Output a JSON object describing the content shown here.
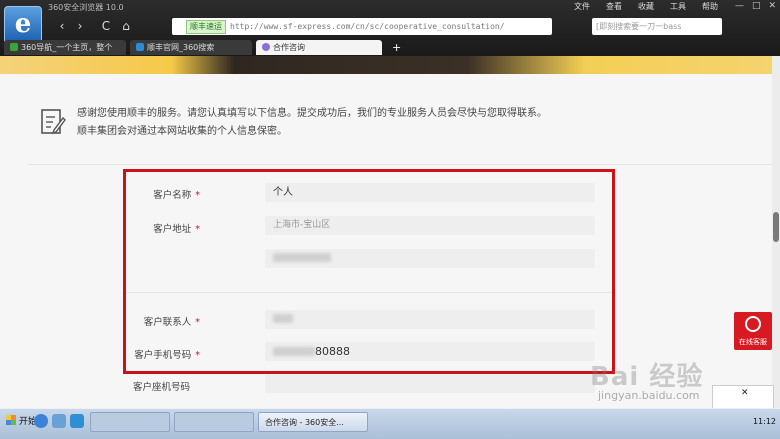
{
  "browser": {
    "app_title": "360安全浏览器 10.0",
    "menu": [
      "文件",
      "查看",
      "收藏",
      "工具",
      "帮助"
    ],
    "nav": {
      "back": "‹",
      "forward": "›",
      "reload": "C",
      "home": "⌂"
    },
    "address": {
      "badge": "顺丰速运",
      "url": "http://www.sf-express.com/cn/sc/cooperative_consultation/"
    },
    "search_placeholder": "[即刻搜索要一刀一bass",
    "tabs": [
      {
        "label": "360导航_一个主页，整个世界",
        "icon_color": "#3aa43a"
      },
      {
        "label": "顺丰官网_360搜索",
        "icon_color": "#2b8bd6"
      },
      {
        "label": "合作咨询",
        "icon_color": "#8a6fd8"
      }
    ],
    "new_tab": "+"
  },
  "page": {
    "notice": [
      "感谢您使用顺丰的服务。请您认真填写以下信息。提交成功后，我们的专业服务人员会尽快与您取得联系。",
      "顺丰集团会对通过本网站收集的个人信息保密。"
    ],
    "form": {
      "customer_name": {
        "label": "客户名称",
        "required": "*",
        "value": "个人"
      },
      "customer_address": {
        "label": "客户地址",
        "required": "*",
        "value": "上海市-宝山区"
      },
      "contact": {
        "label": "客户联系人",
        "required": "*"
      },
      "mobile": {
        "label": "客户手机号码",
        "required": "*",
        "value_suffix": "80888"
      },
      "landline": {
        "label": "客户座机号码"
      }
    },
    "customer_service": "在线客服"
  },
  "watermark": {
    "brand": "Bai 经验",
    "site": "jingyan.baidu.com"
  },
  "taskbar": {
    "start": "开始",
    "active_task": "合作咨询 - 360安全...",
    "clock": "11:12"
  },
  "colors": {
    "highlight_frame": "#cc1118",
    "required_star": "#cc1118",
    "service_button": "#d71a21"
  }
}
